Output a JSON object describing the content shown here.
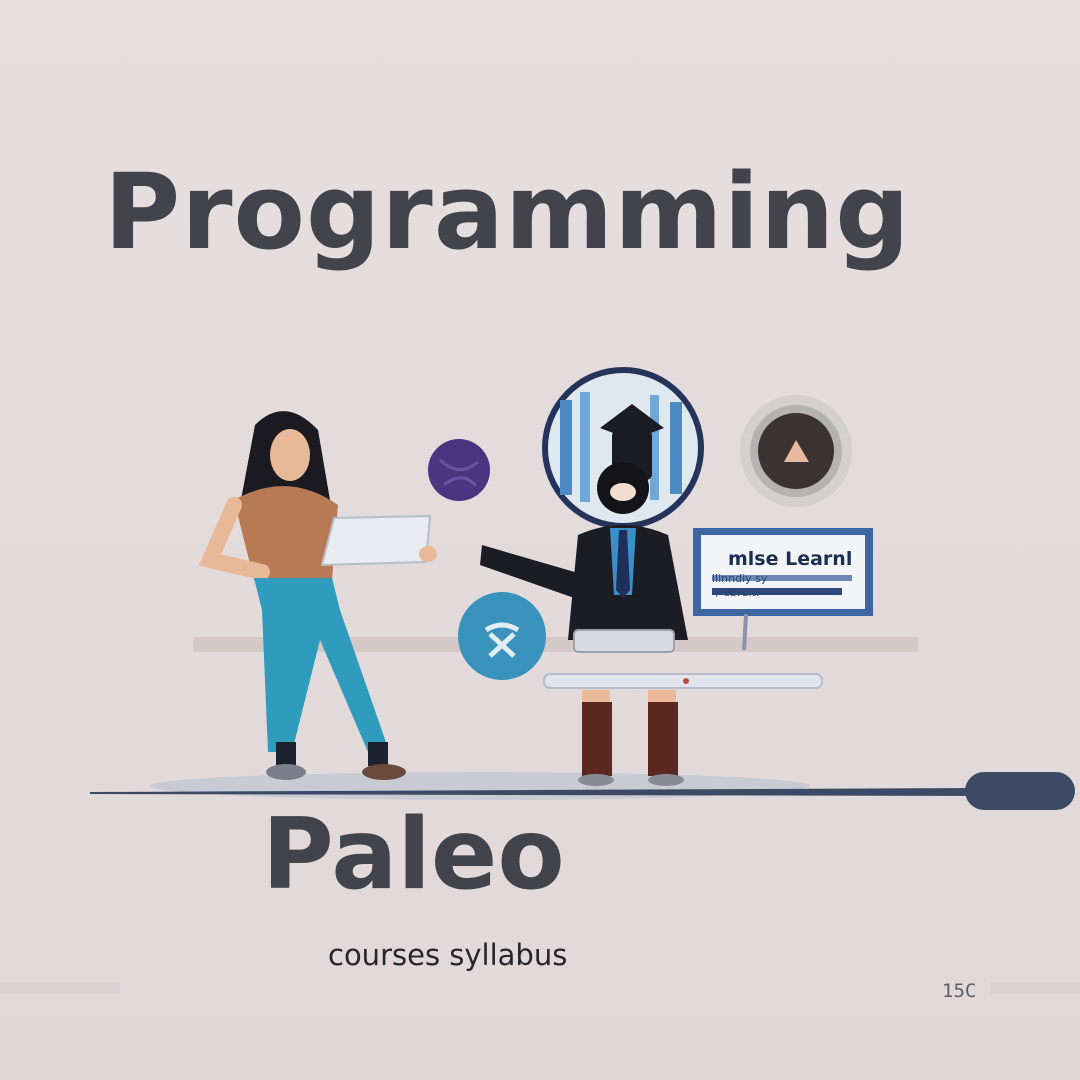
{
  "hero": {
    "title": "Programming",
    "subtitle": "Paleo",
    "tagline": "courses syllabus"
  },
  "illustration": {
    "screen_text": "mlse Learnl",
    "screen_text_lines": [
      "ilinndiy sy",
      "/ ebruitl"
    ]
  },
  "footer": {
    "page_number": "15C"
  },
  "colors": {
    "background": "#e4dcdc",
    "heading": "#42434b",
    "timeline": "#3c4a66",
    "teal": "#3a93bd",
    "purple": "#4a3580",
    "shirt": "#b87a55",
    "jeans": "#2f9bbd",
    "suit": "#1c1c24"
  },
  "icons": [
    "purple-orb-icon",
    "graduate-portrait-icon",
    "play-button-icon",
    "teal-circle-icon",
    "laptop-icon",
    "monitor-icon"
  ]
}
